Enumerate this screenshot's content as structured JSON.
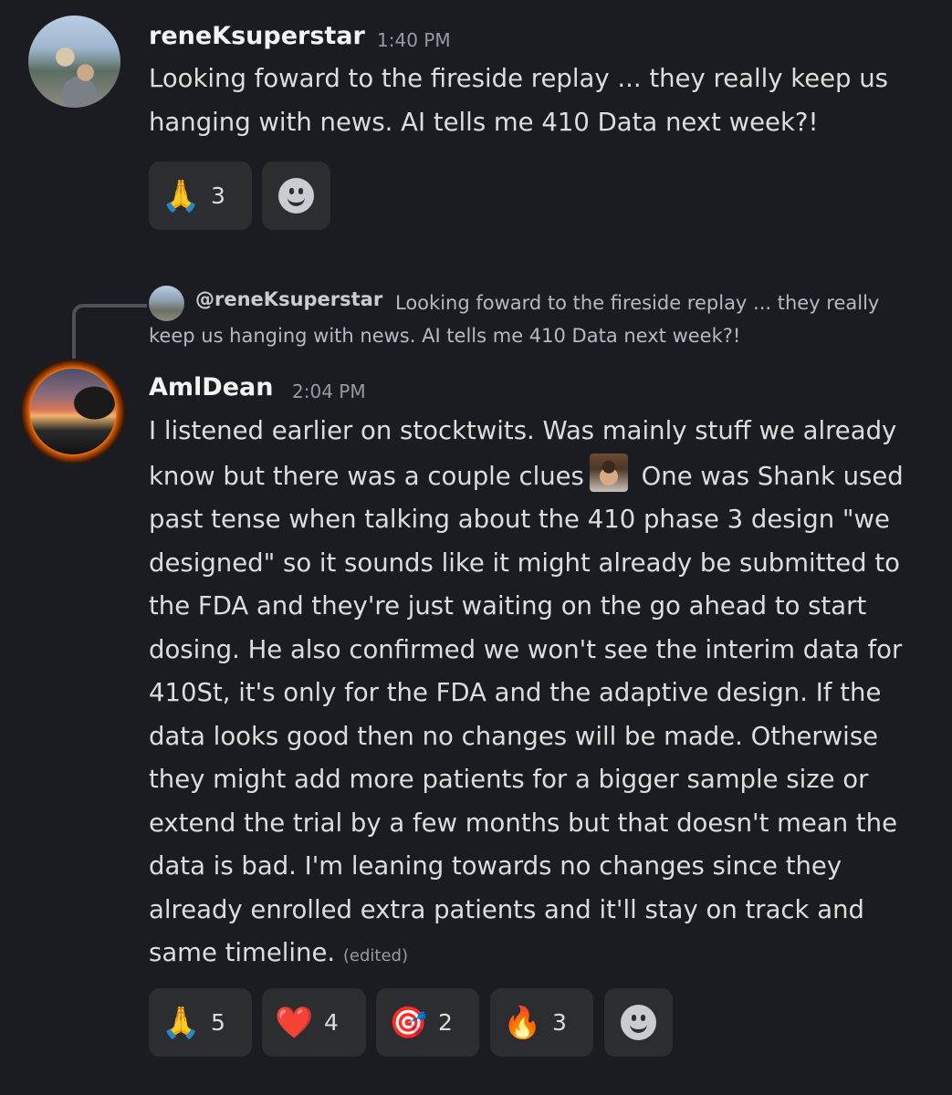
{
  "message1": {
    "username": "reneKsuperstar",
    "timestamp": "1:40 PM",
    "text": "Looking foward to the fireside replay ... they really keep us hanging with news. AI tells me 410 Data next week?!",
    "reactions": [
      {
        "emoji": "🙏",
        "count": "3",
        "icon": "folded-hands-emoji"
      }
    ]
  },
  "reply": {
    "author": "@reneKsuperstar",
    "text": "Looking foward to the fireside replay ... they really keep us hanging with news. AI tells me 410 Data next week?!"
  },
  "message2": {
    "username": "AmlDean",
    "timestamp": "2:04 PM",
    "text_part1": "I listened earlier on stocktwits. Was mainly stuff we already know but there was a couple clues",
    "text_part2": " One was Shank used past tense when talking about the 410 phase 3 design \"we designed\" so it sounds like it might already be submitted to the FDA and they're just waiting on the go ahead to start dosing. He also confirmed we won't see the interim data for 410St, it's only for the FDA and the adaptive design. If the data looks good then no changes will be made. Otherwise they might add more patients for a bigger sample size or extend the trial by a few months but that doesn't mean the data is bad. I'm leaning towards no changes since they already enrolled extra patients and it'll stay on track and same timeline.",
    "edited": "(edited)",
    "reactions": [
      {
        "emoji": "🙏",
        "count": "5",
        "icon": "folded-hands-emoji"
      },
      {
        "emoji": "❤️",
        "count": "4",
        "icon": "red-heart-emoji"
      },
      {
        "emoji": "🎯",
        "count": "2",
        "icon": "direct-hit-emoji"
      },
      {
        "emoji": "🔥",
        "count": "3",
        "icon": "fire-emoji"
      }
    ]
  }
}
